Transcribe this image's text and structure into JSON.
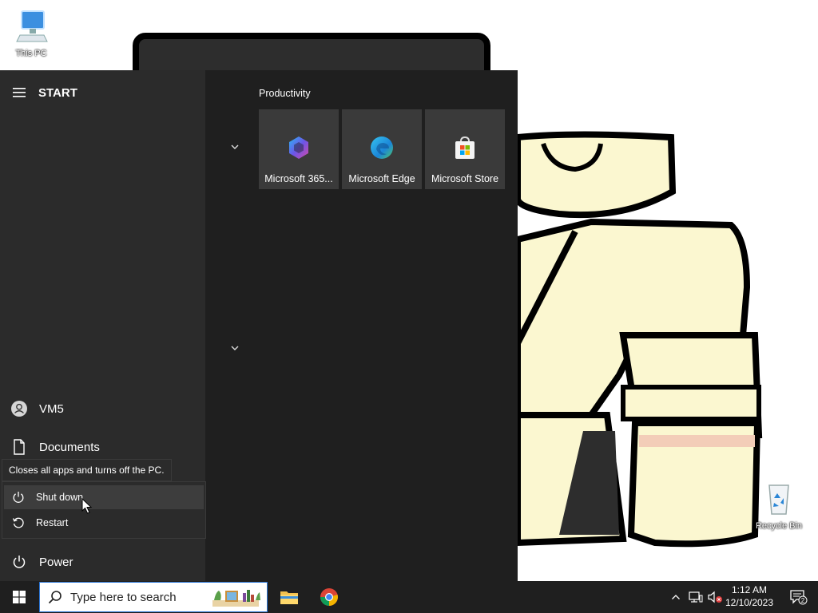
{
  "desktop": {
    "icons": {
      "this_pc": "This PC",
      "recycle_bin": "Recycle Bin"
    }
  },
  "start_menu": {
    "header": "START",
    "group_title": "Productivity",
    "tiles": [
      {
        "label": "Microsoft 365...",
        "icon": "microsoft-365-icon"
      },
      {
        "label": "Microsoft Edge",
        "icon": "edge-icon"
      },
      {
        "label": "Microsoft Store",
        "icon": "store-icon"
      }
    ],
    "nav": {
      "user": "VM5",
      "documents": "Documents",
      "power": "Power"
    },
    "tooltip": "Closes all apps and turns off the PC.",
    "power_menu": {
      "shut_down": "Shut down",
      "restart": "Restart"
    }
  },
  "taskbar": {
    "search_placeholder": "Type here to search",
    "apps": [
      "file-explorer-icon",
      "chrome-icon"
    ],
    "clock": {
      "time": "1:12 AM",
      "date": "12/10/2023"
    },
    "notification_count": "2"
  },
  "colors": {
    "start_bg": "#1f1f1f",
    "left_pane_bg": "#2b2b2b",
    "tile_bg": "#3a3a3a",
    "taskbar_bg": "#1f1f1f",
    "search_border": "#2f78d6",
    "wallpaper_cream": "#fbf7d0"
  }
}
